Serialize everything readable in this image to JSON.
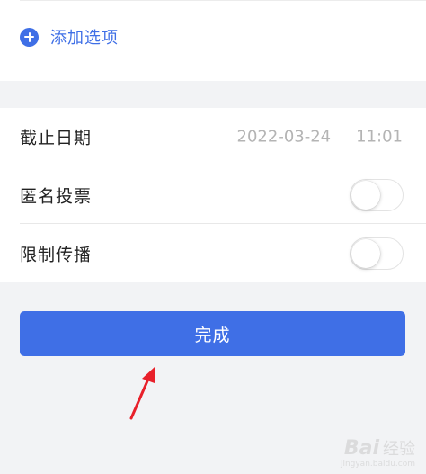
{
  "options": {
    "add_option_label": "添加选项",
    "add_icon": "plus-circle-icon"
  },
  "settings": {
    "deadline": {
      "label": "截止日期",
      "date": "2022-03-24",
      "time": "11:01"
    },
    "anonymous_vote": {
      "label": "匿名投票",
      "enabled": false
    },
    "limit_sharing": {
      "label": "限制传播",
      "enabled": false
    }
  },
  "done_button": {
    "label": "完成"
  },
  "watermark": {
    "logo": "Bai",
    "cn": "经验",
    "url": "jingyan.baidu.com"
  },
  "colors": {
    "accent": "#3f6fe6",
    "background": "#f2f3f5",
    "annotation_arrow": "#e8202a"
  }
}
